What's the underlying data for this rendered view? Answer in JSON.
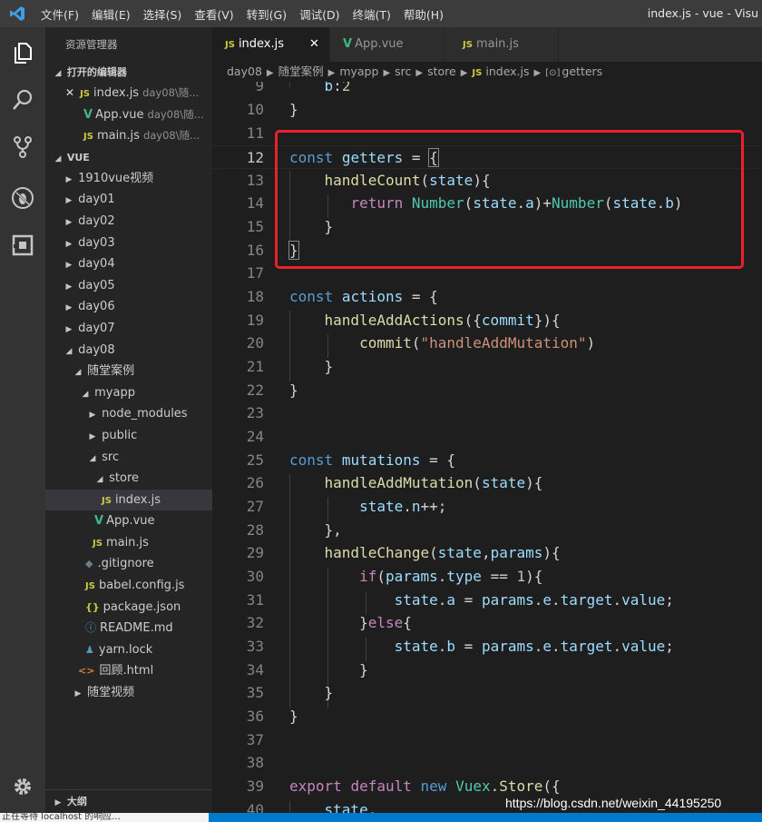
{
  "window": {
    "title": "index.js - vue - Visu",
    "menu": [
      "文件(F)",
      "编辑(E)",
      "选择(S)",
      "查看(V)",
      "转到(G)",
      "调试(D)",
      "终端(T)",
      "帮助(H)"
    ]
  },
  "activity_icons": [
    "files-icon",
    "search-icon",
    "source-control-icon",
    "debug-icon",
    "extensions-icon",
    "gear-icon"
  ],
  "sidebar": {
    "title": "资源管理器",
    "open_editors_header": "打开的编辑器",
    "open_editors": [
      {
        "name": "index.js",
        "desc": "day08\\随...",
        "type": "js"
      },
      {
        "name": "App.vue",
        "desc": "day08\\随...",
        "type": "vue"
      },
      {
        "name": "main.js",
        "desc": "day08\\随...",
        "type": "js"
      }
    ],
    "workspace_header": "VUE",
    "tree": {
      "f1910": "1910vue视频",
      "day01": "day01",
      "day02": "day02",
      "day03": "day03",
      "day04": "day04",
      "day05": "day05",
      "day06": "day06",
      "day07": "day07",
      "day08": "day08",
      "case": "随堂案例",
      "myapp": "myapp",
      "node_modules": "node_modules",
      "public": "public",
      "src": "src",
      "store": "store",
      "indexjs": "index.js",
      "appvue": "App.vue",
      "mainjs": "main.js",
      "gitignore": ".gitignore",
      "babel": "babel.config.js",
      "package": "package.json",
      "readme": "README.md",
      "yarn": "yarn.lock",
      "huigu": "回顾.html",
      "video": "随堂视频"
    },
    "outline_header": "大纲"
  },
  "tabs": [
    {
      "label": "index.js",
      "type": "js",
      "active": true
    },
    {
      "label": "App.vue",
      "type": "vue",
      "active": false
    },
    {
      "label": "main.js",
      "type": "js",
      "active": false
    }
  ],
  "breadcrumb": [
    "day08",
    "随堂案例",
    "myapp",
    "src",
    "store",
    "index.js",
    "getters"
  ],
  "code_line_numbers": [
    "9",
    "10",
    "11",
    "12",
    "13",
    "14",
    "15",
    "16",
    "17",
    "18",
    "19",
    "20",
    "21",
    "22",
    "23",
    "24",
    "25",
    "26",
    "27",
    "28",
    "29",
    "30",
    "31",
    "32",
    "33",
    "34",
    "35",
    "36",
    "37",
    "38",
    "39",
    "40"
  ],
  "current_line": "12",
  "status": {
    "tooltip": "正在等待 localhost 的响应..."
  },
  "watermark": "https://blog.csdn.net/weixin_44195250",
  "colors": {
    "highlight_border": "#e8212a",
    "statusbar": "#007acc",
    "keyword": "#569cd6",
    "function": "#dcdcaa",
    "variable": "#9cdcfe",
    "string": "#ce9178",
    "number": "#b5cea8"
  }
}
